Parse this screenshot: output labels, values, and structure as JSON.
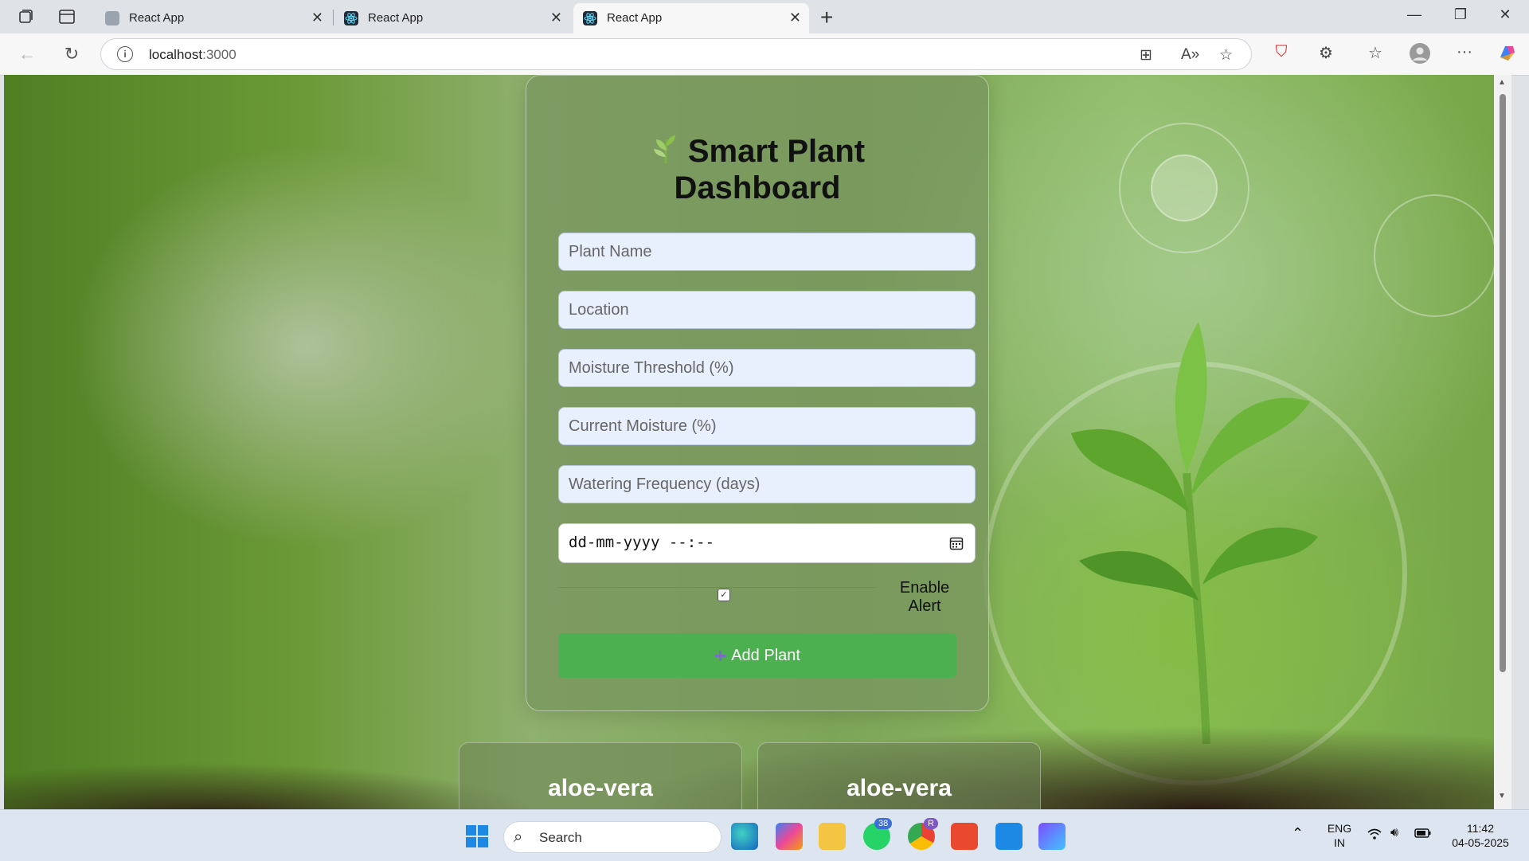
{
  "browser": {
    "tabs": [
      {
        "title": "React App",
        "active": false
      },
      {
        "title": "React App",
        "active": false
      },
      {
        "title": "React App",
        "active": true
      }
    ],
    "url_host": "localhost",
    "url_port": ":3000"
  },
  "dashboard": {
    "title_line1": "Smart Plant",
    "title_line2": "Dashboard",
    "fields": {
      "plant_name": "Plant Name",
      "location": "Location",
      "moisture_threshold": "Moisture Threshold (%)",
      "current_moisture": "Current Moisture (%)",
      "watering_frequency": "Watering Frequency (days)"
    },
    "datetime_placeholder": "dd-mm-yyyy --:--",
    "alert_label_line1": "Enable",
    "alert_label_line2": "Alert",
    "alert_checked": true,
    "add_button_label": "Add Plant",
    "plants": [
      {
        "name": "aloe-vera"
      },
      {
        "name": "aloe-vera"
      }
    ]
  },
  "taskbar": {
    "search_label": "Search",
    "whatsapp_badge": "38",
    "chrome_badge": "R",
    "lang_line1": "ENG",
    "lang_line2": "IN",
    "time": "11:42",
    "date": "04-05-2025"
  },
  "colors": {
    "accent_green": "#4caf50",
    "input_bg": "#e8f0fe"
  }
}
